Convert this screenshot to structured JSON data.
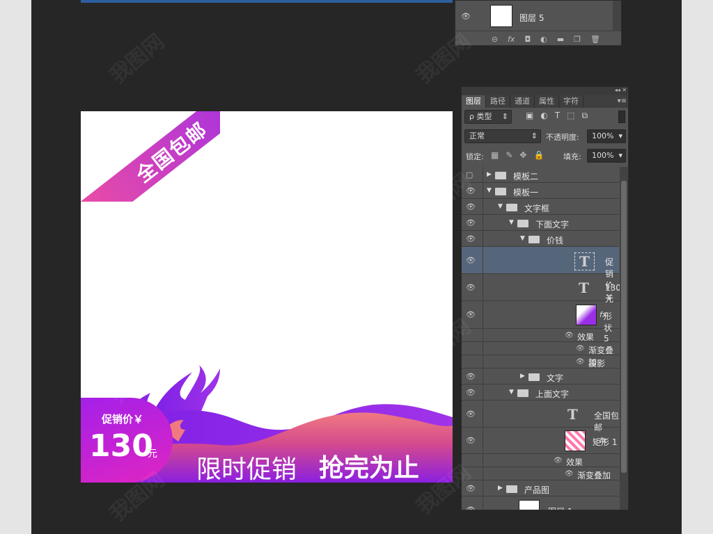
{
  "top_panel": {
    "layer_name": "图层 5",
    "footer_icons": [
      "link-icon",
      "fx-icon",
      "mask-icon",
      "adjustment-icon",
      "folder-icon",
      "new-layer-icon",
      "trash-icon"
    ]
  },
  "canvas": {
    "ribbon_text": "全国包邮",
    "badge_label": "促销价￥",
    "badge_price": "130",
    "badge_unit": "元",
    "slogan_left": "限时促销",
    "slogan_right": "抢完为止",
    "colors": {
      "purple": "#8a2be2",
      "pink": "#f04ea0",
      "salmon": "#f07a80"
    }
  },
  "panel": {
    "tabs": [
      "图层",
      "路径",
      "通道",
      "属性",
      "字符"
    ],
    "filter_kind": "ρ 类型",
    "blend_mode": "正常",
    "opacity_label": "不透明度:",
    "opacity_value": "100%",
    "lock_label": "锁定:",
    "fill_label": "填充:",
    "fill_value": "100%",
    "layers": [
      {
        "name": "模板二",
        "kind": "group",
        "open": false,
        "indent": 0,
        "visible": false
      },
      {
        "name": "模板一",
        "kind": "group",
        "open": true,
        "indent": 0,
        "visible": true
      },
      {
        "name": "文字框",
        "kind": "group",
        "open": true,
        "indent": 1,
        "visible": true
      },
      {
        "name": "下面文字",
        "kind": "group",
        "open": true,
        "indent": 2,
        "visible": true
      },
      {
        "name": "价钱",
        "kind": "group",
        "open": true,
        "indent": 3,
        "visible": true
      },
      {
        "name": "促销价￥",
        "kind": "text",
        "indent": 4,
        "visible": true,
        "selected": true
      },
      {
        "name": "130元",
        "kind": "text",
        "indent": 4,
        "visible": true
      },
      {
        "name": "形状 5",
        "kind": "shape",
        "indent": 4,
        "visible": true,
        "fx": true
      },
      {
        "name": "效果",
        "kind": "effect-group",
        "indent": 4,
        "visible": true
      },
      {
        "name": "渐变叠加",
        "kind": "effect",
        "indent": 5,
        "visible": true
      },
      {
        "name": "投影",
        "kind": "effect",
        "indent": 5,
        "visible": true
      },
      {
        "name": "文字",
        "kind": "group",
        "open": false,
        "indent": 3,
        "visible": true
      },
      {
        "name": "上面文字",
        "kind": "group",
        "open": true,
        "indent": 2,
        "visible": true
      },
      {
        "name": "全国包邮",
        "kind": "text",
        "indent": 3,
        "visible": true
      },
      {
        "name": "矩形 1",
        "kind": "shape2",
        "indent": 3,
        "visible": true,
        "fx": true
      },
      {
        "name": "效果",
        "kind": "effect-group",
        "indent": 3,
        "visible": true
      },
      {
        "name": "渐变叠加",
        "kind": "effect",
        "indent": 4,
        "visible": true
      },
      {
        "name": "产品图",
        "kind": "group",
        "open": false,
        "indent": 1,
        "visible": true
      },
      {
        "name": "图层 1",
        "kind": "pixel",
        "indent": 1,
        "visible": true
      }
    ]
  },
  "watermark": "我图网"
}
